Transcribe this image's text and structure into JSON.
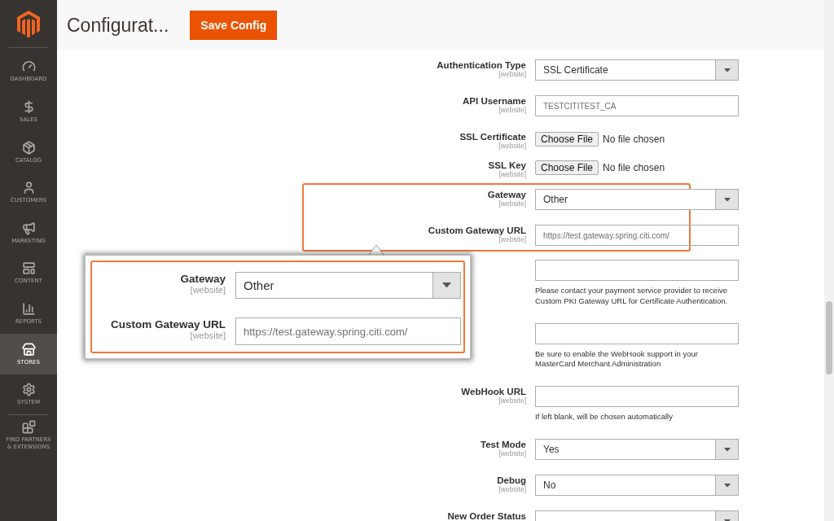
{
  "sidebar": {
    "items": [
      {
        "label": "DASHBOARD",
        "selected": false
      },
      {
        "label": "SALES",
        "selected": false
      },
      {
        "label": "CATALOG",
        "selected": false
      },
      {
        "label": "CUSTOMERS",
        "selected": false
      },
      {
        "label": "MARKETING",
        "selected": false
      },
      {
        "label": "CONTENT",
        "selected": false
      },
      {
        "label": "REPORTS",
        "selected": false
      },
      {
        "label": "STORES",
        "selected": true
      },
      {
        "label": "SYSTEM",
        "selected": false
      },
      {
        "label": "FIND PARTNERS & EXTENSIONS",
        "selected": false
      }
    ]
  },
  "header": {
    "title": "Configurat...",
    "save_button": "Save Config"
  },
  "fields": [
    {
      "kind": "select",
      "label": "Authentication Type",
      "scope": "[website]",
      "value": "SSL Certificate",
      "highlighted": false
    },
    {
      "kind": "text",
      "label": "API Username",
      "scope": "[website]",
      "value": "TESTCITITEST_CA",
      "highlighted": false
    },
    {
      "kind": "file",
      "label": "SSL Certificate",
      "scope": "[website]",
      "button": "Choose File",
      "value": "No file chosen",
      "highlighted": false
    },
    {
      "kind": "file",
      "label": "SSL Key",
      "scope": "[website]",
      "button": "Choose File",
      "value": "No file chosen",
      "highlighted": false
    },
    {
      "kind": "select",
      "label": "Gateway",
      "scope": "[website]",
      "value": "Other",
      "highlighted": true
    },
    {
      "kind": "text",
      "label": "Custom Gateway URL",
      "scope": "[website]",
      "value": "https://test.gateway.spring.citi.com/",
      "highlighted": true
    },
    {
      "kind": "text",
      "note": "Please contact your payment service provider to receive Custom PKI Gateway URL for Certificate Authentication.",
      "highlighted": false
    },
    {
      "kind": "text",
      "note": "Be sure to enable the WebHook support in your MasterCard Merchant Administration",
      "highlighted": false
    },
    {
      "kind": "text",
      "label": "WebHook URL",
      "scope": "[website]",
      "note": "If left blank, will be chosen automatically",
      "highlighted": false
    },
    {
      "kind": "select",
      "label": "Test Mode",
      "scope": "[website]",
      "value": "Yes",
      "highlighted": false
    },
    {
      "kind": "select",
      "label": "Debug",
      "scope": "[website]",
      "value": "No",
      "highlighted": false
    },
    {
      "kind": "select",
      "label": "New Order Status",
      "highlighted": false
    }
  ],
  "callout": {
    "fields": [
      {
        "kind": "select",
        "label": "Gateway",
        "scope": "[website]",
        "value": "Other"
      },
      {
        "kind": "text",
        "label": "Custom Gateway URL",
        "scope": "[website]",
        "value": "https://test.gateway.spring.citi.com/"
      }
    ]
  }
}
